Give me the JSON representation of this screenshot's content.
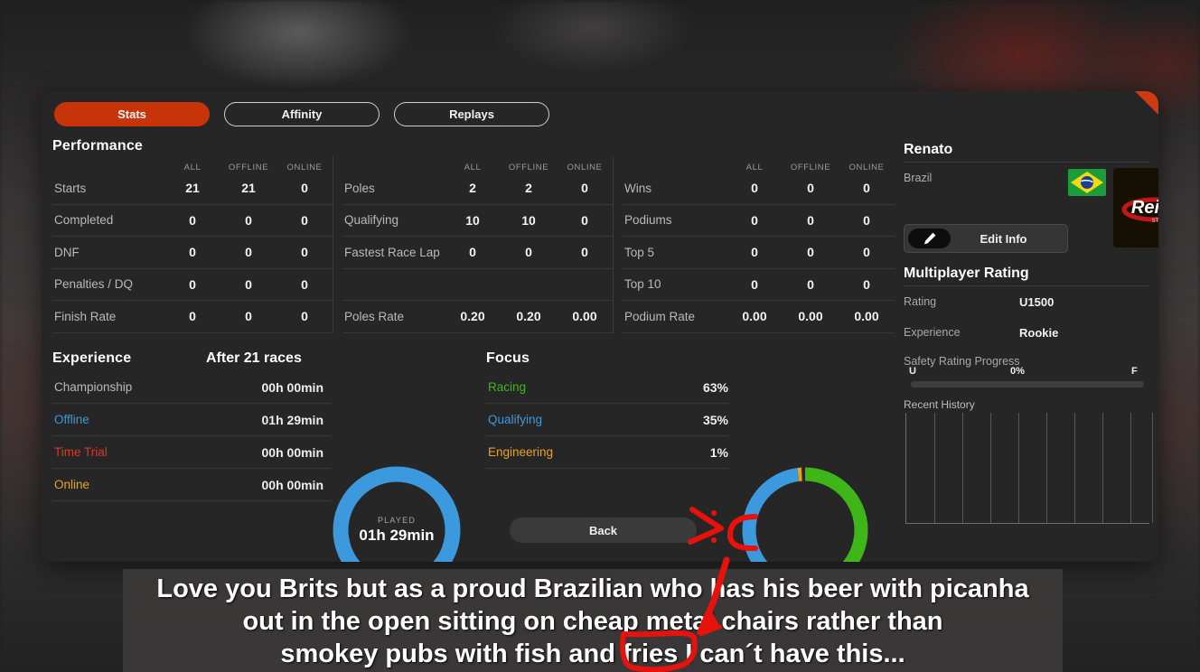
{
  "tabs": [
    {
      "label": "Stats",
      "active": true
    },
    {
      "label": "Affinity",
      "active": false
    },
    {
      "label": "Replays",
      "active": false
    }
  ],
  "performance": {
    "title": "Performance",
    "headers": [
      "ALL",
      "OFFLINE",
      "ONLINE"
    ],
    "columns": [
      {
        "rows": [
          {
            "label": "Starts",
            "values": [
              "21",
              "21",
              "0"
            ]
          },
          {
            "label": "Completed",
            "values": [
              "0",
              "0",
              "0"
            ]
          },
          {
            "label": "DNF",
            "values": [
              "0",
              "0",
              "0"
            ]
          },
          {
            "label": "Penalties / DQ",
            "values": [
              "0",
              "0",
              "0"
            ]
          },
          {
            "label": "Finish Rate",
            "values": [
              "0",
              "0",
              "0"
            ]
          }
        ]
      },
      {
        "rows": [
          {
            "label": "Poles",
            "values": [
              "2",
              "2",
              "0"
            ]
          },
          {
            "label": "Qualifying",
            "values": [
              "10",
              "10",
              "0"
            ]
          },
          {
            "label": "Fastest Race Lap",
            "values": [
              "0",
              "0",
              "0"
            ]
          },
          {
            "label": "",
            "values": [
              "",
              "",
              ""
            ],
            "blank": true
          },
          {
            "label": "Poles Rate",
            "values": [
              "0.20",
              "0.20",
              "0.00"
            ]
          }
        ]
      },
      {
        "rows": [
          {
            "label": "Wins",
            "values": [
              "0",
              "0",
              "0"
            ]
          },
          {
            "label": "Podiums",
            "values": [
              "0",
              "0",
              "0"
            ]
          },
          {
            "label": "Top 5",
            "values": [
              "0",
              "0",
              "0"
            ]
          },
          {
            "label": "Top 10",
            "values": [
              "0",
              "0",
              "0"
            ]
          },
          {
            "label": "Podium Rate",
            "values": [
              "0.00",
              "0.00",
              "0.00"
            ]
          }
        ]
      }
    ]
  },
  "experience": {
    "title": "Experience",
    "subtitle": "After 21 races",
    "rows": [
      {
        "label": "Championship",
        "value": "00h 00min",
        "color": "#b9b9b9"
      },
      {
        "label": "Offline",
        "value": "01h 29min",
        "color": "#3d99dd"
      },
      {
        "label": "Time Trial",
        "value": "00h 00min",
        "color": "#d33a2a"
      },
      {
        "label": "Online",
        "value": "00h 00min",
        "color": "#e8a317"
      }
    ],
    "donut": {
      "caption": "PLAYED",
      "value": "01h 29min",
      "ring_color": "#3d99dd",
      "fill_percent": 100
    }
  },
  "focus": {
    "title": "Focus",
    "rows": [
      {
        "label": "Racing",
        "value": "63%",
        "color": "#3eb618"
      },
      {
        "label": "Qualifying",
        "value": "35%",
        "color": "#3d99dd"
      },
      {
        "label": "Engineering",
        "value": "1%",
        "color": "#e8a317"
      }
    ]
  },
  "chart_data": [
    {
      "type": "pie",
      "title": "Focus",
      "categories": [
        "Racing",
        "Qualifying",
        "Engineering"
      ],
      "values": [
        63,
        35,
        1
      ],
      "colors": [
        "#3eb618",
        "#3d99dd",
        "#e8a317"
      ],
      "legend": "left-table",
      "donut": true
    },
    {
      "type": "pie",
      "title": "Played",
      "categories": [
        "Offline"
      ],
      "values": [
        100
      ],
      "colors": [
        "#3d99dd"
      ],
      "legend": "center-label",
      "donut": true
    },
    {
      "type": "line",
      "title": "Recent History",
      "x": [],
      "values": [],
      "grid": true,
      "xlabel": "",
      "ylabel": ""
    }
  ],
  "back_button": "Back",
  "sidebar": {
    "driver_name": "Renato",
    "country": "Brazil",
    "flag": "brazil-flag",
    "team_logo": "reiza-logo",
    "edit_button": "Edit Info",
    "multiplayer_title": "Multiplayer Rating",
    "stats": [
      {
        "label": "Rating",
        "value": "U1500"
      },
      {
        "label": "Experience",
        "value": "Rookie"
      }
    ],
    "safety": {
      "label": "Safety Rating Progress",
      "start": "U",
      "percent": "0%",
      "end": "F",
      "fill_percent": 0
    },
    "history_label": "Recent History"
  },
  "caption": {
    "lines": [
      "Love you Brits but as a proud Brazilian who has his beer with picanha",
      "out in the open sitting on cheap metal chairs rather than",
      "smokey pubs with fish and fries I can´t have this..."
    ]
  },
  "colors": {
    "accent": "#c8340a",
    "blue": "#3d99dd",
    "green": "#3eb618",
    "orange": "#e8a317",
    "red": "#d33a2a",
    "annotation": "#e8120c"
  }
}
